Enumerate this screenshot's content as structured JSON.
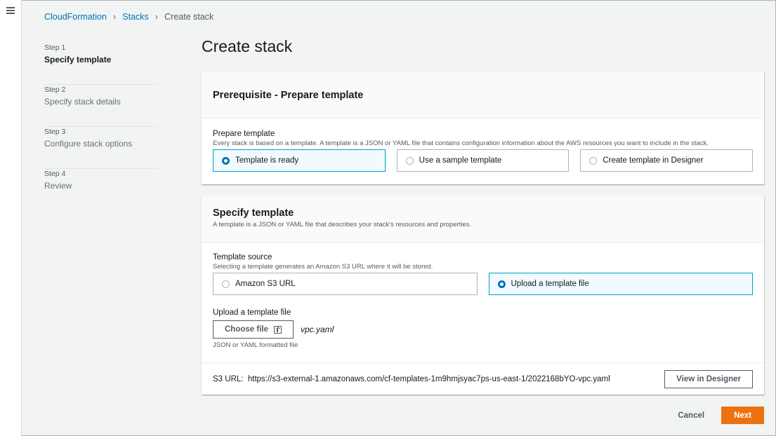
{
  "breadcrumb": {
    "item1": "CloudFormation",
    "item2": "Stacks",
    "current": "Create stack"
  },
  "steps": [
    {
      "num": "Step 1",
      "title": "Specify template"
    },
    {
      "num": "Step 2",
      "title": "Specify stack details"
    },
    {
      "num": "Step 3",
      "title": "Configure stack options"
    },
    {
      "num": "Step 4",
      "title": "Review"
    }
  ],
  "page_title": "Create stack",
  "prereq": {
    "heading": "Prerequisite - Prepare template",
    "label": "Prepare template",
    "desc": "Every stack is based on a template. A template is a JSON or YAML file that contains configuration information about the AWS resources you want to include in the stack.",
    "options": [
      "Template is ready",
      "Use a sample template",
      "Create template in Designer"
    ],
    "selected": "Template is ready"
  },
  "specify": {
    "heading": "Specify template",
    "desc": "A template is a JSON or YAML file that describes your stack's resources and properties.",
    "source_label": "Template source",
    "source_desc": "Selecting a template generates an Amazon S3 URL where it will be stored.",
    "sources": [
      "Amazon S3 URL",
      "Upload a template file"
    ],
    "selected_source": "Upload a template file",
    "upload_label": "Upload a template file",
    "choose_button": "Choose file",
    "file_name": "vpc.yaml",
    "file_hint": "JSON or YAML formatted file",
    "s3_label": "S3 URL:",
    "s3_url": "https://s3-external-1.amazonaws.com/cf-templates-1m9hmjsyac7ps-us-east-1/2022168bYO-vpc.yaml",
    "designer_button": "View in Designer"
  },
  "actions": {
    "cancel": "Cancel",
    "next": "Next"
  },
  "colors": {
    "primary": "#ec7211",
    "link": "#0073bb",
    "selected_border": "#00a1c9"
  }
}
